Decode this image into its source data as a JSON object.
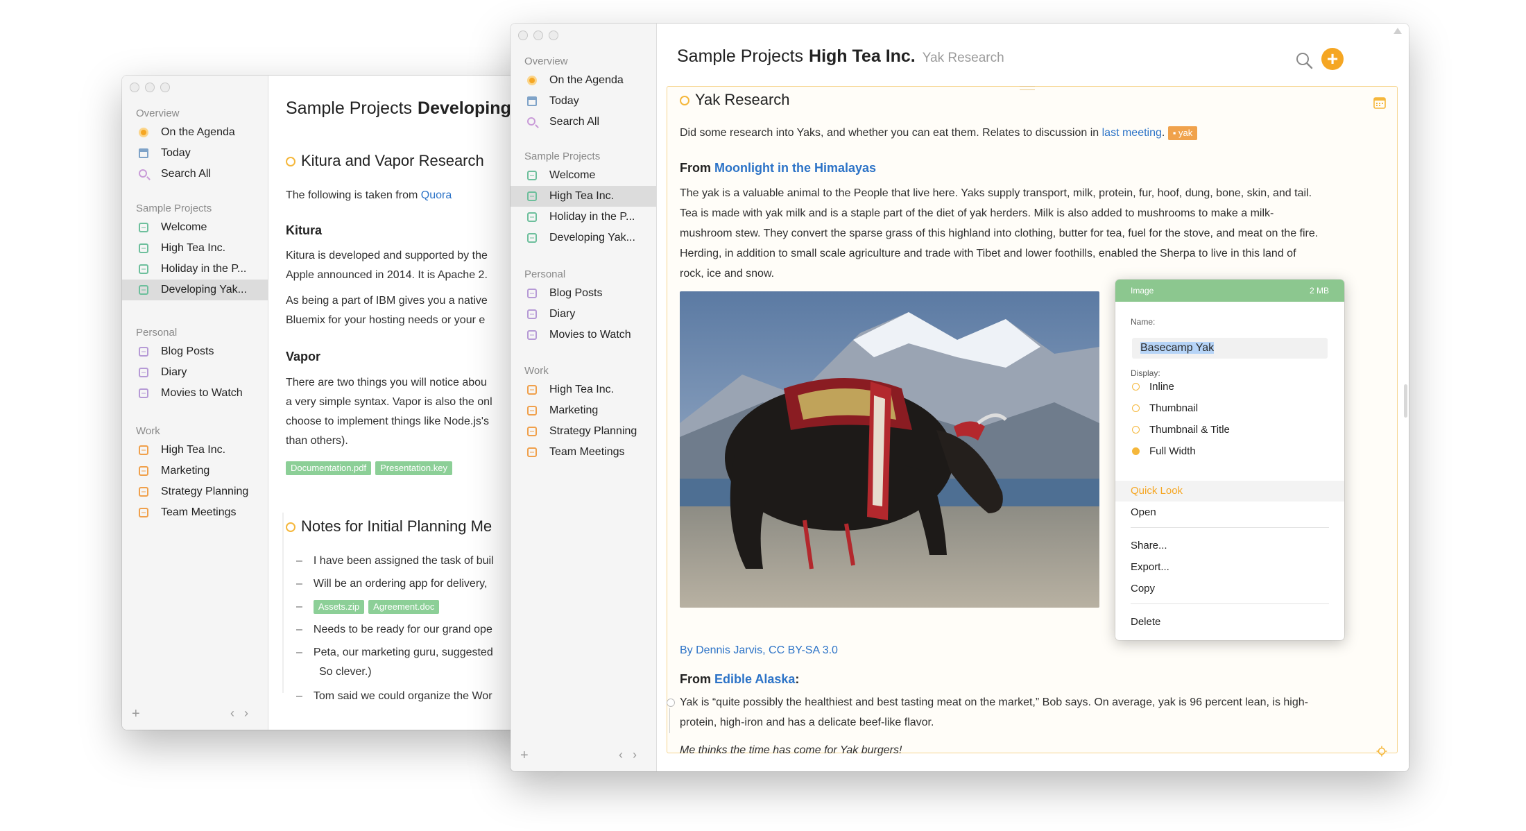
{
  "back_window": {
    "sidebar": {
      "overview_header": "Overview",
      "overview": [
        "On the Agenda",
        "Today",
        "Search All"
      ],
      "sample_header": "Sample Projects",
      "sample": [
        "Welcome",
        "High Tea Inc.",
        "Holiday in the P...",
        "Developing Yak..."
      ],
      "personal_header": "Personal",
      "personal": [
        "Blog Posts",
        "Diary",
        "Movies to Watch"
      ],
      "work_header": "Work",
      "work": [
        "High Tea Inc.",
        "Marketing",
        "Strategy Planning",
        "Team Meetings"
      ]
    },
    "crumb": {
      "project": "Sample Projects",
      "page": "Developing"
    },
    "doc": {
      "title": "Kitura and Vapor Research",
      "intro": "The following is taken from",
      "intro_link": "Quora",
      "h_kitura": "Kitura",
      "kitura_1": "Kitura is developed and supported by the",
      "kitura_2": "Apple announced in 2014. It is Apache 2.",
      "kitura_3": "As being a part of IBM gives you a native",
      "kitura_4": "Bluemix for your hosting needs or your e",
      "h_vapor": "Vapor",
      "vapor_1": "There are two things you will notice abou",
      "vapor_2": "a very simple syntax. Vapor is also the onl",
      "vapor_3": "choose to implement things like Node.js's",
      "vapor_4": "than others).",
      "chips": [
        "Documentation.pdf",
        "Presentation.key"
      ],
      "notes_title": "Notes for Initial Planning Me",
      "notes": [
        "I have been assigned the task of buil",
        "Will be an ordering app for delivery,",
        "",
        "Needs to be ready for our grand ope",
        "Peta, our marketing guru, suggested"
      ],
      "notes_chips": [
        "Assets.zip",
        "Agreement.doc"
      ],
      "notes_cont": "So clever.)",
      "notes_last": "Tom said we could organize the Wor"
    }
  },
  "front_window": {
    "sidebar": {
      "overview_header": "Overview",
      "overview": [
        "On the Agenda",
        "Today",
        "Search All"
      ],
      "sample_header": "Sample Projects",
      "sample": [
        "Welcome",
        "High Tea Inc.",
        "Holiday in the P...",
        "Developing Yak..."
      ],
      "personal_header": "Personal",
      "personal": [
        "Blog Posts",
        "Diary",
        "Movies to Watch"
      ],
      "work_header": "Work",
      "work": [
        "High Tea Inc.",
        "Marketing",
        "Strategy Planning",
        "Team Meetings"
      ]
    },
    "crumb": {
      "project": "Sample Projects",
      "page": "High Tea Inc.",
      "sub": "Yak Research"
    },
    "doc": {
      "title": "Yak Research",
      "intro": "Did some research into Yaks, and whether you can eat them. Relates to discussion in",
      "intro_link": "last meeting",
      "tag": "yak",
      "from1_label": "From",
      "from1_link": "Moonlight in the Himalayas",
      "para1": [
        "The yak is a valuable animal to the People that live here. Yaks supply transport, milk, protein, fur, hoof, dung, bone, skin, and tail.",
        "Tea is made with yak milk and is a staple part of the diet of yak herders. Milk is also added to mushrooms to make a milk-",
        "mushroom stew. They convert the sparse grass of this highland into clothing, butter for tea, fuel for the stove, and meat on the fire.",
        "Herding, in addition to small scale agriculture and trade with Tibet and lower foothills, enabled the Sherpa to live in this land of",
        "rock, ice and snow."
      ],
      "caption": "By Dennis Jarvis, CC BY-SA 3.0",
      "from2_label": "From",
      "from2_link": "Edible Alaska",
      "para2": [
        "Yak is “quite possibly the healthiest and best tasting meat on the market,” Bob says. On average, yak is 96 percent lean, is high-",
        "protein, high-iron and has a delicate beef-like flavor."
      ],
      "italic": "Me thinks the time has come for Yak burgers!"
    },
    "popover": {
      "header": "Image",
      "size": "2 MB",
      "name_label": "Name:",
      "name_value": "Basecamp Yak",
      "display_label": "Display:",
      "display_options": [
        "Inline",
        "Thumbnail",
        "Thumbnail & Title",
        "Full Width"
      ],
      "selected_display": "Full Width",
      "actions": [
        "Quick Look",
        "Open",
        "Share...",
        "Export...",
        "Copy",
        "Delete"
      ]
    }
  },
  "colors": {
    "accent": "#f5a623",
    "link": "#2c73c7",
    "tag_green": "#8ccf97",
    "popover_header": "#8cc78f"
  }
}
